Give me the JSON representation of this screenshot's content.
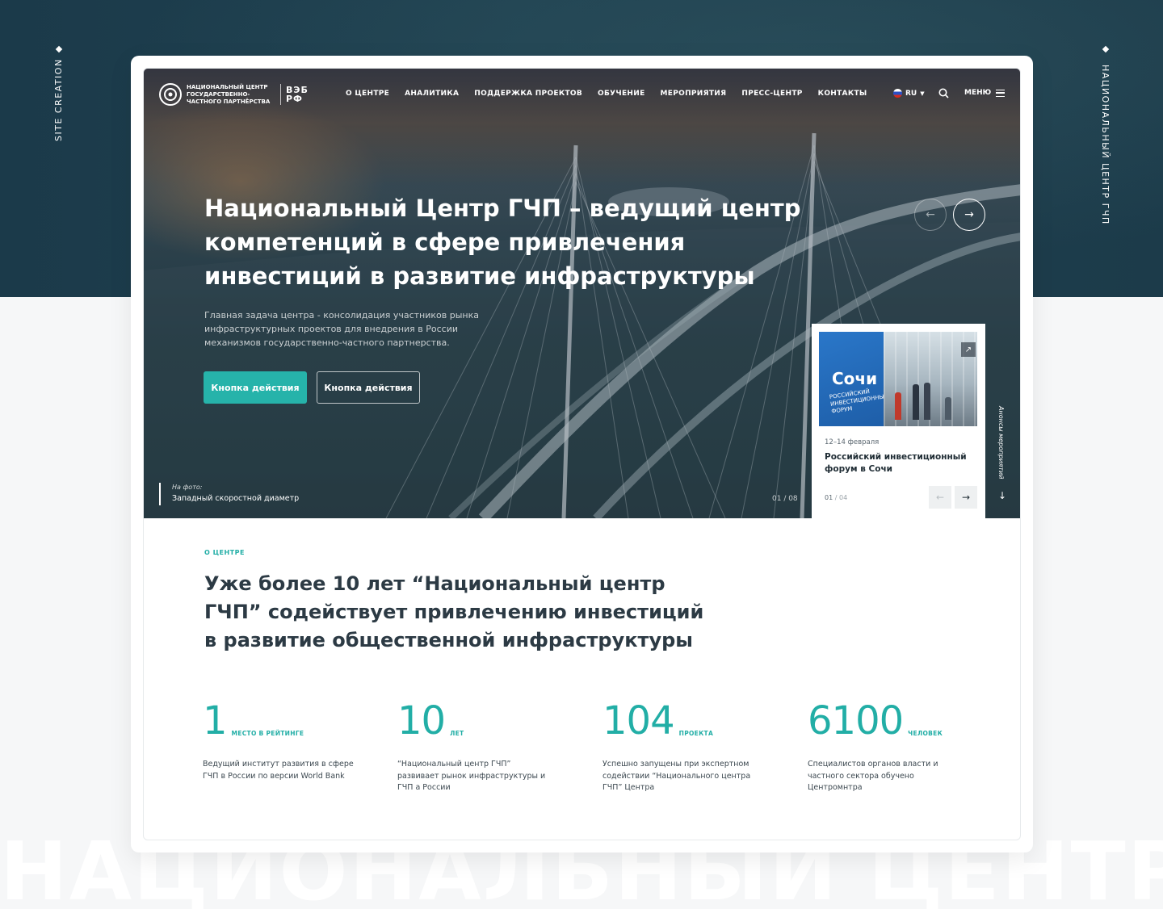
{
  "side": {
    "left_label": "SITE CREATION",
    "right_label": "НАЦИОНАЛЬНЫЙ ЦЕНТР ГЧП"
  },
  "watermark": "НАЦИОНАЛЬНЫЙ ЦЕНТР ГЧП",
  "header": {
    "logo_text": "НАЦИОНАЛЬНЫЙ ЦЕНТР ГОСУДАРСТВЕННО-ЧАСТНОГО ПАРТНЁРСТВА",
    "partner_logo_line1": "ВЭБ",
    "partner_logo_line2": "РФ",
    "nav": [
      "О ЦЕНТРЕ",
      "АНАЛИТИКА",
      "ПОДДЕРЖКА ПРОЕКТОВ",
      "ОБУЧЕНИЕ",
      "МЕРОПРИЯТИЯ",
      "ПРЕСС-ЦЕНТР",
      "КОНТАКТЫ"
    ],
    "lang": "RU",
    "menu_label": "МЕНЮ"
  },
  "hero": {
    "title": "Национальный Центр ГЧП – ведущий центр компетенций в сфере привлечения инвестиций в развитие инфраструктуры",
    "subtitle": "Главная задача центра - консолидация участников рынка инфраструктурных проектов для внедрения в России механизмов государственно-частного партнерства.",
    "primary_button": "Кнопка действия",
    "secondary_button": "Кнопка действия",
    "photo_caption_label": "На фото:",
    "photo_caption": "Западный скоростной диаметр",
    "slide_counter": "01 / 08"
  },
  "event": {
    "image_text": "Сочи",
    "image_subtext": "РОССИЙСКИЙ ИНВЕСТИЦИОННЫЙ ФОРУМ",
    "date": "12–14 февраля",
    "title": "Российский инвестиционный форум в Сочи",
    "counter_current": "01",
    "counter_total": "/ 04",
    "side_label": "Анонсы мероприятий"
  },
  "about": {
    "eyebrow": "О ЦЕНТРЕ",
    "title": "Уже более 10 лет “Национальный центр ГЧП” содействует привлечению инвестиций в развитие общественной инфраструктуры",
    "stats": [
      {
        "num": "1",
        "unit": "МЕСТО В РЕЙТИНГЕ",
        "desc": "Ведущий институт развития в сфере ГЧП в России по версии World Bank"
      },
      {
        "num": "10",
        "unit": "ЛЕТ",
        "desc": "“Национальный центр ГЧП” развивает рынок инфраструктуры и ГЧП а России"
      },
      {
        "num": "104",
        "unit": "ПРОЕКТА",
        "desc": "Успешно запущены при экспертном содействии “Национального центра ГЧП” Центра"
      },
      {
        "num": "6100",
        "unit": "ЧЕЛОВЕК",
        "desc": "Специалистов органов власти и частного сектора обучено Центромнтра"
      }
    ]
  },
  "colors": {
    "accent": "#26b3aa",
    "dark_bg": "#1c3b4a",
    "text_dark": "#2c3a44"
  }
}
